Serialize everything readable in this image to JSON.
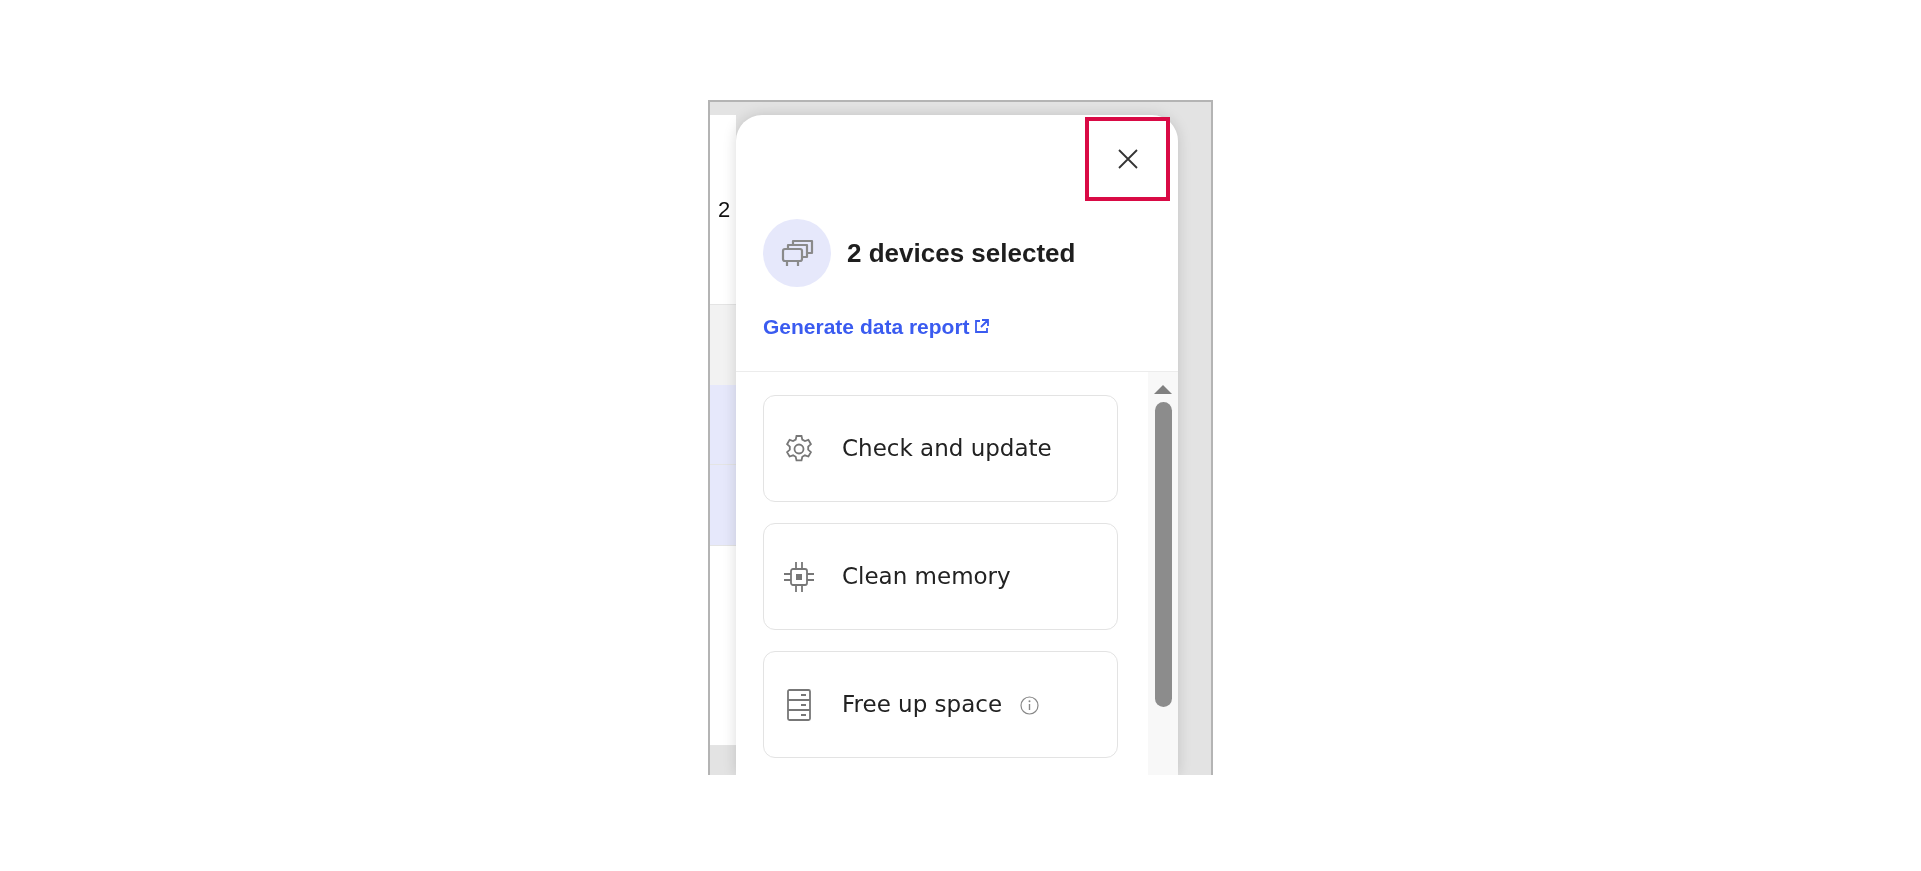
{
  "background_table": {
    "rows": [
      {
        "kind": "row",
        "text": "2"
      },
      {
        "kind": "band"
      },
      {
        "kind": "row",
        "selected": true
      },
      {
        "kind": "row",
        "selected": true
      },
      {
        "kind": "row",
        "selected": false
      }
    ]
  },
  "panel": {
    "close_button": {
      "highlighted": true
    },
    "title": "2 devices selected",
    "link": "Generate data report",
    "actions": [
      {
        "kind": "gear",
        "label": "Check and update",
        "info": false
      },
      {
        "kind": "chip",
        "label": "Clean memory",
        "info": false
      },
      {
        "kind": "storage",
        "label": "Free up space",
        "info": true
      }
    ]
  }
}
